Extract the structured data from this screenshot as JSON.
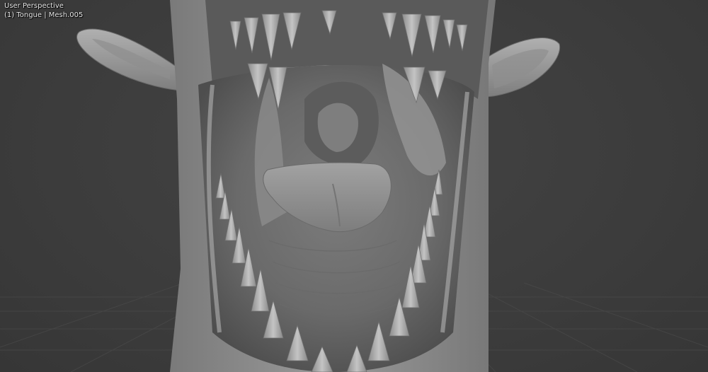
{
  "viewport": {
    "view_name": "User Perspective",
    "object_info": "(1) Tongue | Mesh.005"
  },
  "colors": {
    "background": "#3d3d3d",
    "grid_line": "#4a4a4a",
    "mesh_light": "#a9a9a9",
    "mesh_mid": "#8a8a8a",
    "mesh_dark": "#5e5e5e",
    "mouth_interior": "#6f6f6f"
  }
}
